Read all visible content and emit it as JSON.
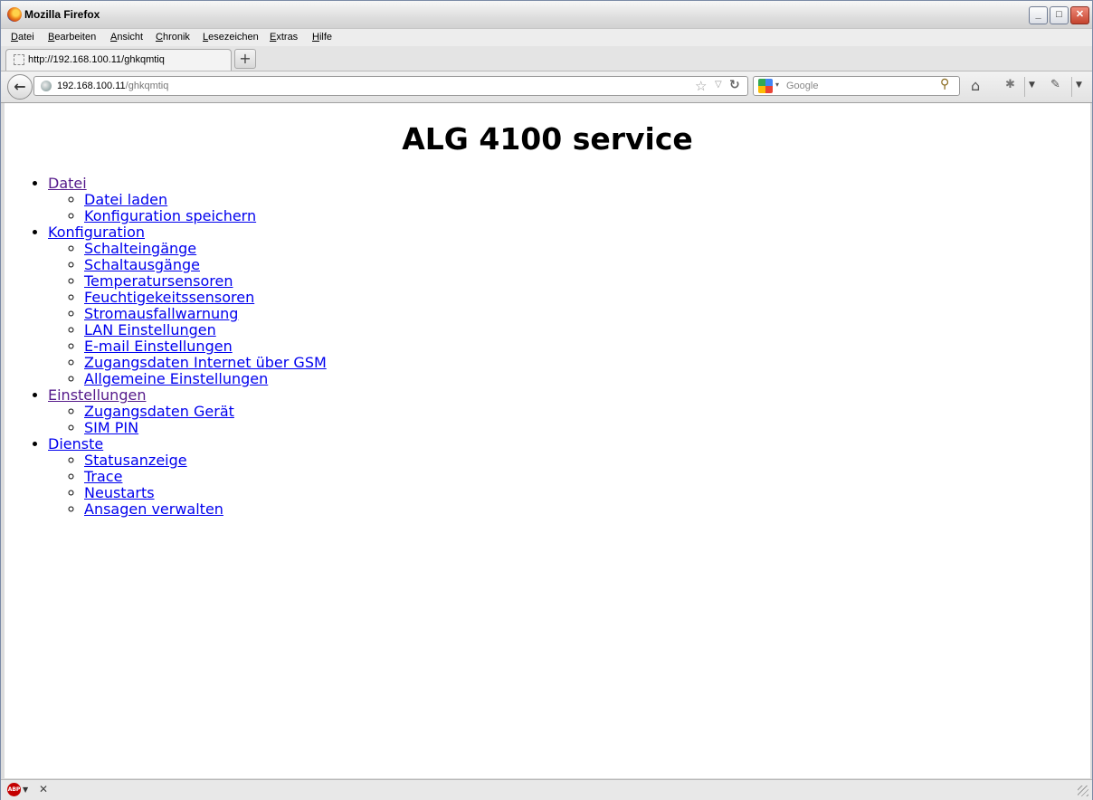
{
  "window": {
    "title": "Mozilla Firefox"
  },
  "menu": [
    "Datei",
    "Bearbeiten",
    "Ansicht",
    "Chronik",
    "Lesezeichen",
    "Extras",
    "Hilfe"
  ],
  "tab": {
    "label": "http://192.168.100.11/ghkqmtiq",
    "new_tab": "+"
  },
  "urlbar": {
    "host": "192.168.100.11",
    "path": "/ghkqmtiq"
  },
  "search": {
    "placeholder": "Google"
  },
  "page": {
    "title": "ALG 4100 service",
    "sections": [
      {
        "label": "Datei",
        "visited": true,
        "items": [
          "Datei laden",
          "Konfiguration speichern"
        ]
      },
      {
        "label": "Konfiguration",
        "visited": false,
        "items": [
          "Schalteingänge",
          "Schaltausgänge",
          "Temperatursensoren",
          "Feuchtigekeitssensoren",
          "Stromausfallwarnung",
          "LAN Einstellungen",
          "E-mail Einstellungen",
          "Zugangsdaten Internet über GSM",
          "Allgemeine Einstellungen"
        ]
      },
      {
        "label": "Einstellungen",
        "visited": true,
        "items": [
          "Zugangsdaten Gerät",
          "SIM PIN"
        ]
      },
      {
        "label": "Dienste",
        "visited": false,
        "items": [
          "Statusanzeige",
          "Trace",
          "Neustarts",
          "Ansagen verwalten"
        ]
      }
    ]
  },
  "colors": {
    "link": "#0000ee",
    "visited_link": "#551a8b"
  },
  "icons": [
    "firefox-logo-icon",
    "back-arrow-icon",
    "globe-icon",
    "bookmark-star-icon",
    "reload-icon",
    "google-icon",
    "magnifier-icon",
    "home-icon",
    "addon-icon",
    "adblock-plus-icon"
  ]
}
